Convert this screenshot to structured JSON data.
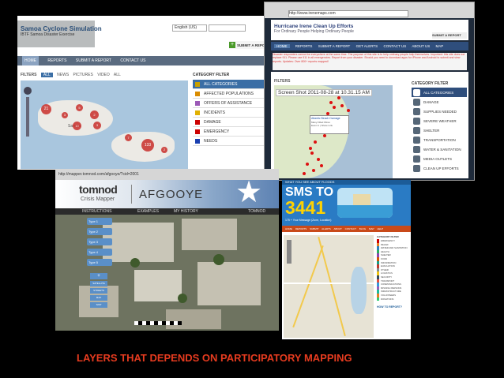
{
  "caption": "LAYERS THAT DEPENDS ON PARTICIPATORY MAPPING",
  "samoa": {
    "title": "Samoa Cyclone Simulation",
    "subtitle": "IBTF Samoa Disaster Exercise",
    "language": "English (US)",
    "submit": "SUBMIT A REPORT",
    "nav": [
      "HOME",
      "REPORTS",
      "SUBMIT A REPORT",
      "CONTACT US"
    ],
    "filters_label": "FILTERS",
    "filters": [
      "ALL",
      "NEWS",
      "PICTURES",
      "VIDEO",
      "ALL"
    ],
    "category_filter": "CATEGORY FILTER",
    "categories": [
      {
        "label": "ALL CATEGORIES",
        "color": "#c8a000"
      },
      {
        "label": "AFFECTED POPULATIONS",
        "color": "#d98c00"
      },
      {
        "label": "OFFERS OF ASSISTANCE",
        "color": "#9b59b6"
      },
      {
        "label": "INCIDENTS",
        "color": "#e0b000"
      },
      {
        "label": "DAMAGE",
        "color": "#cc0000"
      },
      {
        "label": "EMERGENCY",
        "color": "#cc0000"
      },
      {
        "label": "NEEDS",
        "color": "#1a3fb0"
      }
    ],
    "clusters": [
      "21",
      "3",
      "5",
      "2",
      "3",
      "10",
      "7",
      "133",
      "2"
    ],
    "place": "Samoa"
  },
  "irene": {
    "title": "Hurricane Irene Clean Up Efforts",
    "subtitle": "For Ordinary People Helping Ordinary People",
    "url": "http://www.irenemaps.com",
    "submit": "SUBMIT A REPORT",
    "nav": [
      "HOME",
      "REPORTS",
      "SUBMIT A REPORT",
      "GET ALERTS",
      "CONTACT US",
      "ABOUT US",
      "MAP"
    ],
    "notice": "Disaster responders cannot be everywhere at the same time. The purpose of this site is to help ordinary people help themselves. Important: this site does not replace 911. Please use 911 in all emergencies. Report from your disaster. Should you need to download apps for iPhone and Android to submit and view reports. Updates: Over 800+ reports mapped!",
    "screenshot_label": "Screen Shot 2011-08-28 at 10.31.15 AM",
    "filters_label": "FILTERS",
    "popup": [
      "Atlantic Beach Damage",
      "Many Filled Wires",
      "Event 1 | Share Link"
    ],
    "category_filter": "CATEGORY FILTER",
    "categories": [
      "ALL CATEGORIES",
      "DAMAGE",
      "SUPPLIES NEEDED",
      "SEVERE WEATHER",
      "SHELTER",
      "TRANSPORTATION",
      "WATER & SANITATION",
      "MEDIA OUTLETS",
      "CLEAN UP EFFORTS"
    ]
  },
  "afgooye": {
    "url": "http://mapper.tomnod.com/afgooye/?cid=2001",
    "logo": "tomnod",
    "logo_sub": "Crisis Mapper",
    "title": "AFGOOYE",
    "nav": [
      "INSTRUCTIONS",
      "EXAMPLES",
      "MY HISTORY",
      "TOMNOD"
    ],
    "layers": [
      "Type 1",
      "Type 2",
      "Type 3",
      "Type 4",
      "Type 5"
    ],
    "controls": [
      "SATELLITE",
      "STREETS",
      "MAP",
      "SKIP"
    ]
  },
  "sms": {
    "banner": "WHAT YOU SEE ABOUT FLOODS",
    "title": "SMS TO",
    "number": "3441",
    "tagline": "175 + Your Message (Zone, Location)",
    "nav": [
      "HOME",
      "REPORTS",
      "SUBMIT",
      "ALERTS",
      "ABOUT",
      "CONTACT",
      "BLOG",
      "MAP",
      "HELP"
    ],
    "category_filter": "CATEGORY FILTER",
    "categories": [
      "EMERGENCY",
      "RELIEF",
      "WATER AND SANITATION",
      "HEALTH",
      "SHELTER",
      "FOOD",
      "INFORMATION",
      "EVACUATION",
      "OTHER",
      "LOGISTICS",
      "SECURITY",
      "TRANSPORT",
      "COMMUNICATIONS",
      "MISSING PERSONS",
      "INFRASTRUCTURE",
      "VOLUNTEERS",
      "DONATIONS"
    ],
    "how_to": "HOW TO REPORT?"
  }
}
